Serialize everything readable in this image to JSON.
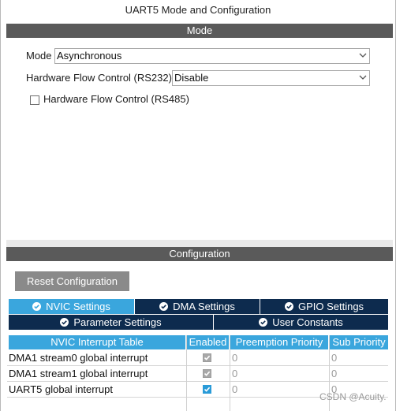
{
  "window": {
    "title": "UART5 Mode and Configuration"
  },
  "mode_section": {
    "header": "Mode",
    "mode_label": "Mode",
    "mode_value": "Asynchronous",
    "hw_flow_rs232_label": "Hardware Flow Control (RS232)",
    "hw_flow_rs232_value": "Disable",
    "hw_flow_rs485_label": "Hardware Flow Control (RS485)",
    "hw_flow_rs485_checked": false
  },
  "config_section": {
    "header": "Configuration",
    "reset_button": "Reset Configuration",
    "tabs_row1": [
      {
        "label": "NVIC Settings",
        "active": true
      },
      {
        "label": "DMA Settings",
        "active": false
      },
      {
        "label": "GPIO Settings",
        "active": false
      }
    ],
    "tabs_row2": [
      {
        "label": "Parameter Settings",
        "active": false
      },
      {
        "label": "User Constants",
        "active": false
      }
    ],
    "table": {
      "columns": [
        "NVIC Interrupt Table",
        "Enabled",
        "Preemption Priority",
        "Sub Priority"
      ],
      "rows": [
        {
          "name": "DMA1 stream0 global interrupt",
          "enabled": true,
          "enabled_editable": false,
          "preemption": "0",
          "sub": "0"
        },
        {
          "name": "DMA1 stream1 global interrupt",
          "enabled": true,
          "enabled_editable": false,
          "preemption": "0",
          "sub": "0"
        },
        {
          "name": "UART5 global interrupt",
          "enabled": true,
          "enabled_editable": true,
          "preemption": "0",
          "sub": "0"
        }
      ]
    }
  },
  "watermark": "CSDN @Acuity.",
  "colors": {
    "header_bg": "#5a5a5a",
    "tab_bg": "#0d2b4e",
    "tab_active_bg": "#3aa6dd",
    "table_header_bg": "#3aa6dd",
    "checkbox_on": "#2a9bd8"
  },
  "icons": {
    "tab_icon": "check-circle-icon",
    "select_arrow": "chevron-down-icon"
  }
}
